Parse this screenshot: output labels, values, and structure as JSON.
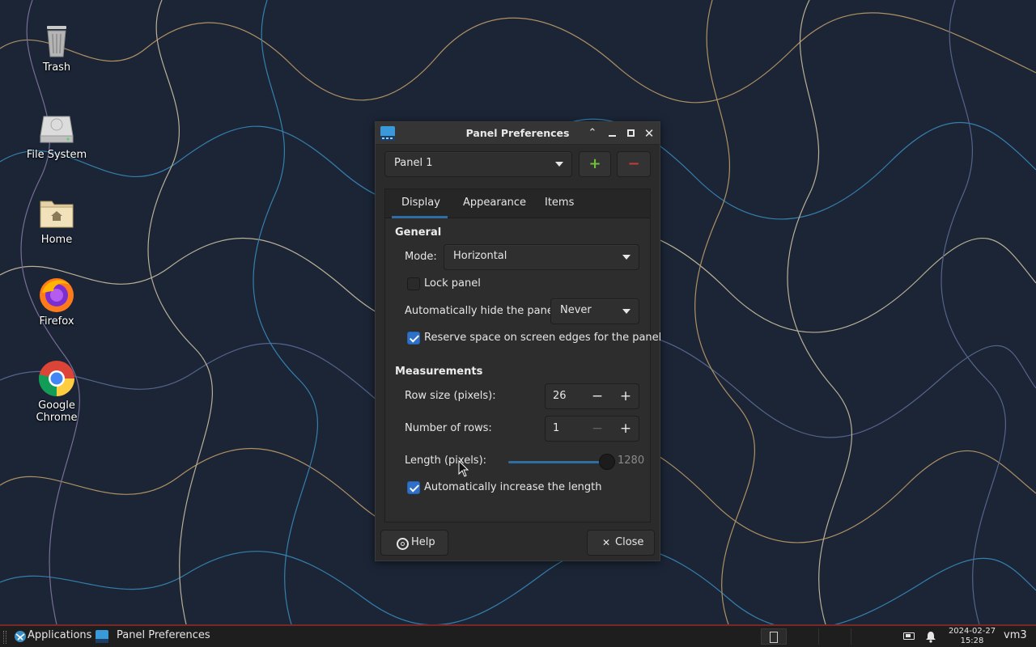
{
  "desktop": {
    "icons": [
      {
        "label": "Trash",
        "icon": "trash-icon"
      },
      {
        "label": "File System",
        "icon": "drive-icon"
      },
      {
        "label": "Home",
        "icon": "home-folder-icon"
      },
      {
        "label": "Firefox",
        "icon": "firefox-icon"
      },
      {
        "label": "Google Chrome",
        "icon": "chrome-icon"
      }
    ]
  },
  "window": {
    "title": "Panel Preferences",
    "panel_select": "Panel 1",
    "add_label": "+",
    "remove_label": "−",
    "tabs": [
      {
        "label": "Display",
        "active": true
      },
      {
        "label": "Appearance",
        "active": false
      },
      {
        "label": "Items",
        "active": false
      }
    ],
    "general": {
      "heading": "General",
      "mode_label": "Mode:",
      "mode_value": "Horizontal",
      "lock_label": "Lock panel",
      "lock_checked": false,
      "autohide_label": "Automatically hide the panel:",
      "autohide_value": "Never",
      "reserve_label": "Reserve space on screen edges for the panel",
      "reserve_checked": true
    },
    "measurements": {
      "heading": "Measurements",
      "row_size_label": "Row size (pixels):",
      "row_size_value": "26",
      "rows_label": "Number of rows:",
      "rows_value": "1",
      "length_label": "Length (pixels):",
      "length_value": "1280",
      "length_fraction": 1.0,
      "auto_length_label": "Automatically increase the length",
      "auto_length_checked": true
    },
    "help_label": "Help",
    "close_label": "Close"
  },
  "taskbar": {
    "applications_label": "Applications",
    "task_label": "Panel Preferences",
    "date": "2024-02-27",
    "time": "15:28",
    "workspace": "vm3"
  },
  "colors": {
    "accent": "#2f6ea5",
    "check": "#2f70c8",
    "add": "#6fbf3a",
    "remove": "#c83a3a",
    "taskbar_border": "#7a2727"
  }
}
